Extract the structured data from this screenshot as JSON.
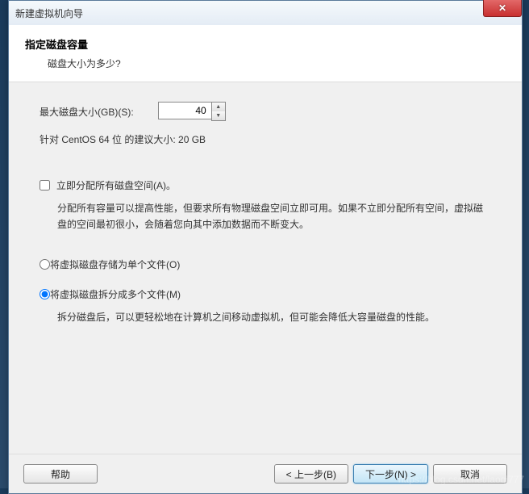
{
  "window": {
    "title": "新建虚拟机向导"
  },
  "header": {
    "title": "指定磁盘容量",
    "subtitle": "磁盘大小为多少?"
  },
  "disk": {
    "label": "最大磁盘大小(GB)(S):",
    "value": "40",
    "recommend": "针对 CentOS 64 位 的建议大小: 20 GB"
  },
  "allocate": {
    "label": "立即分配所有磁盘空间(A)。",
    "desc": "分配所有容量可以提高性能，但要求所有物理磁盘空间立即可用。如果不立即分配所有空间，虚拟磁盘的空间最初很小，会随着您向其中添加数据而不断变大。",
    "checked": false
  },
  "store": {
    "single": "将虚拟磁盘存储为单个文件(O)",
    "split": "将虚拟磁盘拆分成多个文件(M)",
    "splitDesc": "拆分磁盘后，可以更轻松地在计算机之间移动虚拟机，但可能会降低大容量磁盘的性能。",
    "selected": "split"
  },
  "buttons": {
    "help": "帮助",
    "back": "< 上一步(B)",
    "next": "下一步(N) >",
    "cancel": "取消"
  },
  "watermark": "https://blog.csdn.net/laoqi777"
}
